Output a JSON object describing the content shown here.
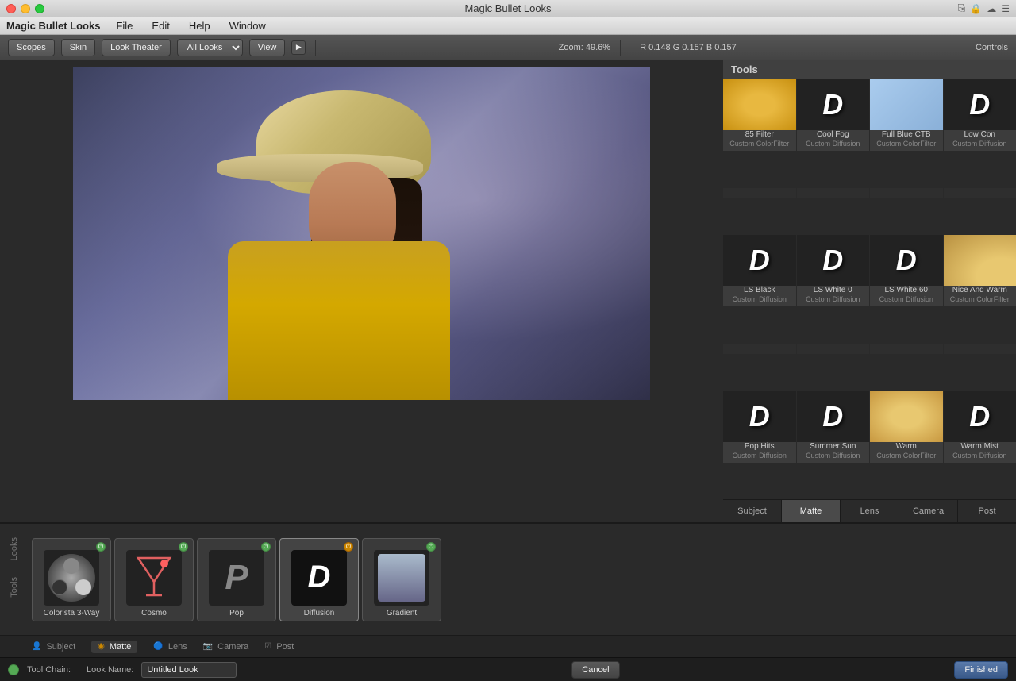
{
  "app": {
    "title": "Magic Bullet Looks",
    "menu": [
      "Magic Bullet Looks",
      "File",
      "Edit",
      "Help",
      "Window"
    ]
  },
  "toolbar": {
    "scopes_label": "Scopes",
    "skin_label": "Skin",
    "look_theater_label": "Look Theater",
    "all_looks_label": "All Looks",
    "view_label": "View",
    "zoom_label": "Zoom:",
    "zoom_value": "49.6%",
    "rgb": "R 0.148   G 0.157   B 0.157",
    "controls_label": "Controls"
  },
  "tools": {
    "header": "Tools",
    "tabs": [
      "Subject",
      "Matte",
      "Lens",
      "Camera",
      "Post"
    ],
    "active_tab": "Matte",
    "grid": [
      {
        "name": "85 Filter",
        "category": "Custom ColorFilter",
        "thumb": "warm"
      },
      {
        "name": "Cool Fog",
        "category": "Custom Diffusion",
        "thumb": "d"
      },
      {
        "name": "Full Blue CTB",
        "category": "Custom ColorFilter",
        "thumb": "blue"
      },
      {
        "name": "Low Con",
        "category": "Custom Diffusion",
        "thumb": "d"
      },
      {
        "name": "",
        "category": "",
        "thumb": "empty"
      },
      {
        "name": "",
        "category": "",
        "thumb": "empty"
      },
      {
        "name": "",
        "category": "",
        "thumb": "empty"
      },
      {
        "name": "",
        "category": "",
        "thumb": "empty"
      },
      {
        "name": "LS Black",
        "category": "Custom Diffusion",
        "thumb": "d"
      },
      {
        "name": "LS White 0",
        "category": "Custom Diffusion",
        "thumb": "d"
      },
      {
        "name": "LS White 60",
        "category": "Custom Diffusion",
        "thumb": "d"
      },
      {
        "name": "Nice And Warm",
        "category": "Custom ColorFilter",
        "thumb": "niceandwarm"
      },
      {
        "name": "",
        "category": "",
        "thumb": "empty"
      },
      {
        "name": "",
        "category": "",
        "thumb": "empty"
      },
      {
        "name": "",
        "category": "",
        "thumb": "empty"
      },
      {
        "name": "",
        "category": "",
        "thumb": "empty"
      },
      {
        "name": "Pop Hits",
        "category": "Custom Diffusion",
        "thumb": "d"
      },
      {
        "name": "Summer Sun",
        "category": "Custom Diffusion",
        "thumb": "d"
      },
      {
        "name": "Warm",
        "category": "Custom ColorFilter",
        "thumb": "warm"
      },
      {
        "name": "Warm Mist",
        "category": "Custom Diffusion",
        "thumb": "d"
      }
    ]
  },
  "toolchain": {
    "looks_label": "Looks",
    "tools_label": "Tools",
    "items": [
      {
        "name": "Colorista 3-Way",
        "type": "colorista",
        "power": true
      },
      {
        "name": "Cosmo",
        "type": "cosmo",
        "power": true
      },
      {
        "name": "Pop",
        "type": "pop",
        "power": true
      },
      {
        "name": "Diffusion",
        "type": "diffusion",
        "power": true
      },
      {
        "name": "Gradient",
        "type": "gradient",
        "power": true
      }
    ]
  },
  "chain_tabs": [
    {
      "label": "Subject",
      "active": false,
      "icon": "person"
    },
    {
      "label": "Matte",
      "active": true,
      "icon": "circle"
    },
    {
      "label": "Lens",
      "active": false,
      "icon": "lens"
    },
    {
      "label": "Camera",
      "active": false,
      "icon": "camera"
    },
    {
      "label": "Post",
      "active": false,
      "icon": "post"
    }
  ],
  "footer": {
    "tool_chain_label": "Tool Chain:",
    "look_name_label": "Look Name:",
    "look_name_value": "Untitled Look",
    "cancel_label": "Cancel",
    "finished_label": "Finished"
  }
}
